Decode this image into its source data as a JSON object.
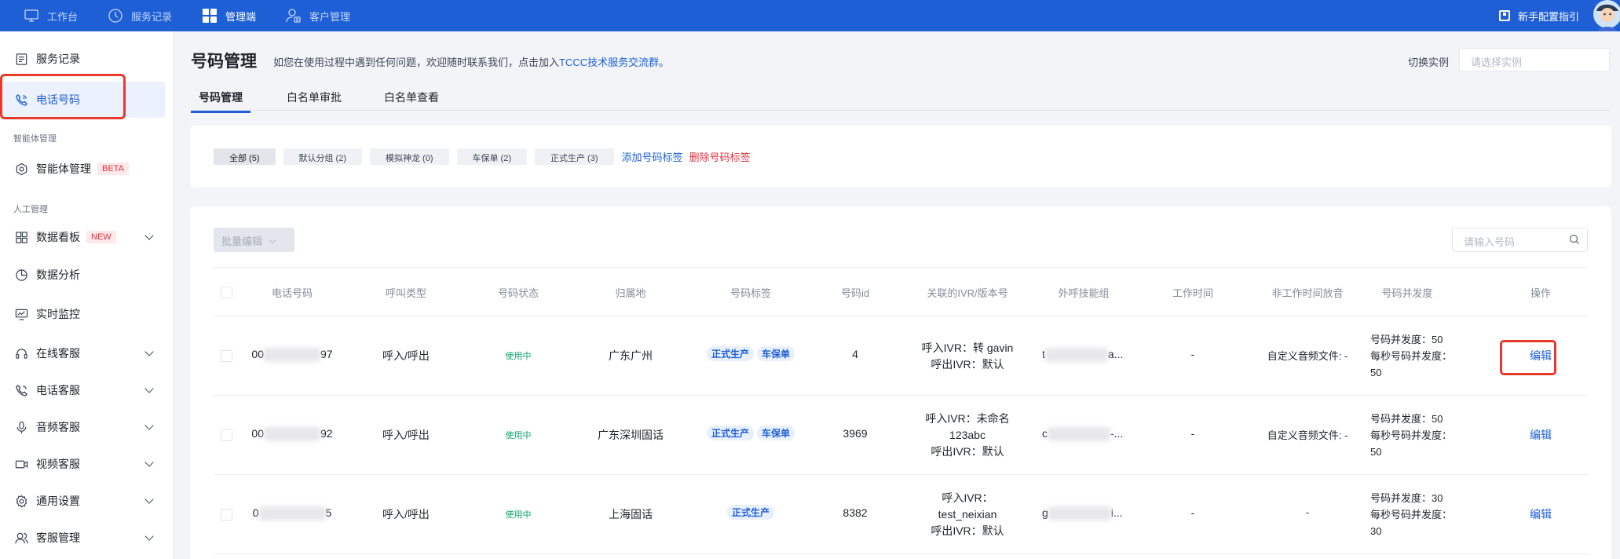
{
  "topbar": {
    "nav": [
      {
        "label": "工作台",
        "icon": "monitor-icon"
      },
      {
        "label": "服务记录",
        "icon": "clock-icon"
      },
      {
        "label": "管理端",
        "icon": "grid-icon"
      },
      {
        "label": "客户管理",
        "icon": "user-management-icon"
      }
    ],
    "active_nav": "管理端",
    "guide_label": "新手配置指引"
  },
  "sidebar": {
    "items": [
      {
        "label": "服务记录",
        "icon": "document-icon"
      },
      {
        "label": "电话号码",
        "icon": "phone-icon"
      }
    ],
    "group1": "智能体管理",
    "agent_item": {
      "label": "智能体管理",
      "badge": "BETA",
      "icon": "hexagon-icon"
    },
    "group2": "人工管理",
    "manual_items": [
      {
        "label": "数据看板",
        "badge": "NEW",
        "icon": "dashboard-icon"
      },
      {
        "label": "数据分析",
        "icon": "pie-chart-icon"
      },
      {
        "label": "实时监控",
        "icon": "monitor-chart-icon"
      },
      {
        "label": "在线客服",
        "icon": "headset-icon"
      },
      {
        "label": "电话客服",
        "icon": "phone-icon"
      },
      {
        "label": "音频客服",
        "icon": "microphone-icon"
      },
      {
        "label": "视频客服",
        "icon": "video-icon"
      },
      {
        "label": "通用设置",
        "icon": "gear-icon"
      },
      {
        "label": "客服管理",
        "icon": "people-icon"
      }
    ],
    "active": "电话号码"
  },
  "header": {
    "title": "号码管理",
    "desc_prefix": "如您在使用过程中遇到任何问题，欢迎随时联系我们，点击加入",
    "desc_link": "TCCC技术服务交流群",
    "desc_suffix": "。",
    "switch_label": "切换实例",
    "switch_placeholder": "请选择实例"
  },
  "tabs": [
    "号码管理",
    "白名单审批",
    "白名单查看"
  ],
  "active_tab": "号码管理",
  "filters": {
    "chips": [
      "全部 (5)",
      "默认分组 (2)",
      "模拟神龙 (0)",
      "车保单 (2)",
      "正式生产 (3)"
    ],
    "active_chip": "全部 (5)",
    "add_label": "添加号码标签",
    "delete_label": "删除号码标签"
  },
  "toolbar": {
    "batch_label": "批量编辑",
    "search_placeholder": "请输入号码"
  },
  "table": {
    "headers": [
      "电话号码",
      "呼叫类型",
      "号码状态",
      "归属地",
      "号码标签",
      "号码id",
      "关联的IVR/版本号",
      "外呼技能组",
      "工作时间",
      "非工作时间放音",
      "号码并发度",
      "操作"
    ],
    "rows": [
      {
        "phone_start": "00",
        "phone_end": "97",
        "call_type": "呼入/呼出",
        "status": "使用中",
        "location": "广东广州",
        "tags": [
          "正式生产",
          "车保单"
        ],
        "id": "4",
        "ivr": [
          "呼入IVR：转 gavin",
          "呼出IVR：默认"
        ],
        "skill_start": "t",
        "skill_end": "a...",
        "work_time": "-",
        "off_audio": "自定义音频文件: -",
        "concurrency": [
          "号码并发度：50",
          "每秒号码并发度：",
          "50"
        ],
        "action": "编辑"
      },
      {
        "phone_start": "00",
        "phone_end": "92",
        "call_type": "呼入/呼出",
        "status": "使用中",
        "location": "广东深圳固话",
        "tags": [
          "正式生产",
          "车保单"
        ],
        "id": "3969",
        "ivr": [
          "呼入IVR：未命名",
          "123abc",
          "呼出IVR：默认"
        ],
        "skill_start": "c",
        "skill_end": "-...",
        "work_time": "-",
        "off_audio": "自定义音频文件: -",
        "concurrency": [
          "号码并发度：50",
          "每秒号码并发度：",
          "50"
        ],
        "action": "编辑"
      },
      {
        "phone_start": "0",
        "phone_end": "5",
        "call_type": "呼入/呼出",
        "status": "使用中",
        "location": "上海固话",
        "tags": [
          "正式生产"
        ],
        "id": "8382",
        "ivr": [
          "呼入IVR：",
          "test_neixian",
          "呼出IVR：默认"
        ],
        "skill_start": "g",
        "skill_end": "i...",
        "work_time": "-",
        "off_audio": "-",
        "concurrency": [
          "号码并发度：30",
          "每秒号码并发度：",
          "30"
        ],
        "action": "编辑"
      }
    ]
  },
  "colors": {
    "brand": "#1e5fd6",
    "highlight": "#e8392d",
    "status_green": "#0ba668",
    "danger": "#e0303e"
  }
}
